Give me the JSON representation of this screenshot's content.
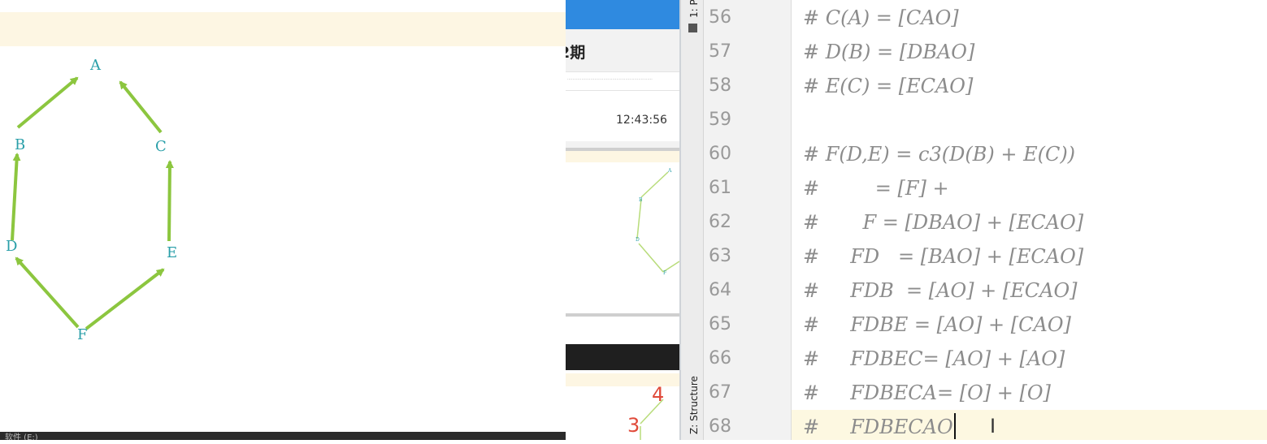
{
  "whiteboard": {
    "nodes": [
      "A",
      "B",
      "C",
      "D",
      "E",
      "F"
    ],
    "taskbar_text": "软件 (E:)"
  },
  "browser_panel": {
    "title": "2期",
    "timestamp": "12:43:56",
    "annotations": [
      "4",
      "3"
    ]
  },
  "ide": {
    "tool_windows": [
      "1: P",
      "Z: Structure"
    ],
    "lines": [
      {
        "num": "56",
        "code": "# C(A) = [CAO]"
      },
      {
        "num": "57",
        "code": "# D(B) = [DBAO]"
      },
      {
        "num": "58",
        "code": "# E(C) = [ECAO]"
      },
      {
        "num": "59",
        "code": ""
      },
      {
        "num": "60",
        "code": "# F(D,E) = c3(D(B) + E(C))"
      },
      {
        "num": "61",
        "code": "#         = [F] +"
      },
      {
        "num": "62",
        "code": "#       F = [DBAO] + [ECAO]"
      },
      {
        "num": "63",
        "code": "#     FD   = [BAO] + [ECAO]"
      },
      {
        "num": "64",
        "code": "#     FDB  = [AO] + [ECAO]"
      },
      {
        "num": "65",
        "code": "#     FDBE = [AO] + [CAO]"
      },
      {
        "num": "66",
        "code": "#     FDBEC= [AO] + [AO]"
      },
      {
        "num": "67",
        "code": "#     FDBECA= [O] + [O]"
      },
      {
        "num": "68",
        "code": "#     FDBECAO"
      }
    ],
    "colors": {
      "comment": "#8c8c8c",
      "line_number": "#999999",
      "current_line": "#fdf8e1"
    }
  }
}
